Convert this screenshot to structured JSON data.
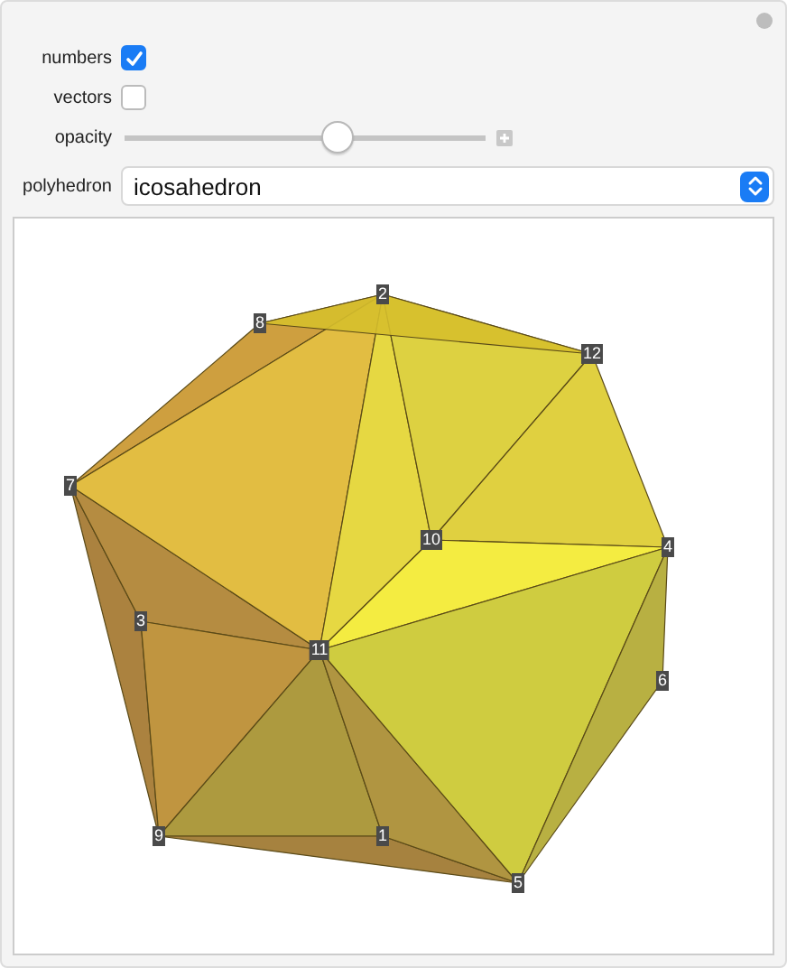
{
  "controls": [
    {
      "kind": "checkbox",
      "label": "numbers",
      "checked": true
    },
    {
      "kind": "checkbox",
      "label": "vectors",
      "checked": false
    },
    {
      "kind": "slider",
      "label": "opacity",
      "level": 0.59
    },
    {
      "kind": "dropdown",
      "label": "polyhedron",
      "value": "icosahedron"
    }
  ],
  "graphic": {
    "vertex_labels": [
      "1",
      "2",
      "3",
      "4",
      "5",
      "6",
      "7",
      "8",
      "9",
      "10",
      "11",
      "12"
    ]
  }
}
